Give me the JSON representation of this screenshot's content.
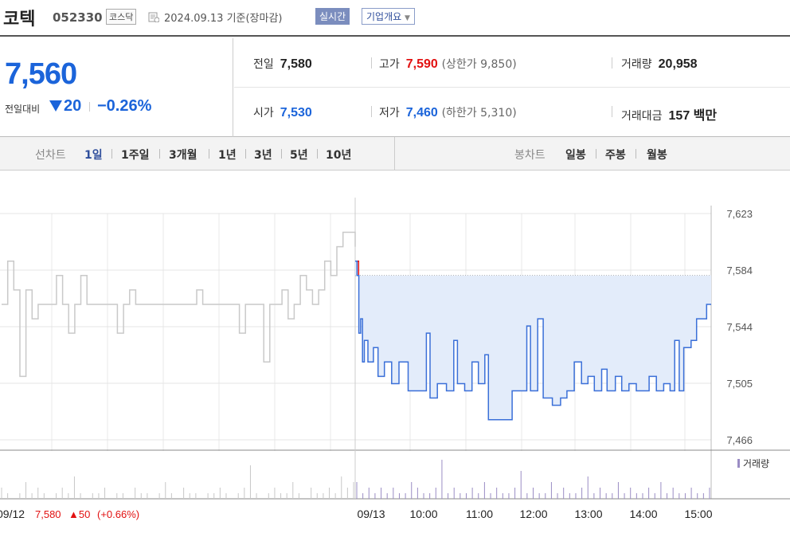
{
  "header": {
    "name": "코텍",
    "code": "052330",
    "market": "코스닥",
    "date": "2024.09.13  기준(장마감)",
    "realtime_label": "실시간",
    "corp_label": "기업개요"
  },
  "quote": {
    "price": "7,560",
    "change_label": "전일대비",
    "change_value": "20",
    "change_pct": "−0.26%",
    "prev_label": "전일",
    "prev": "7,580",
    "high_label": "고가",
    "high": "7,590",
    "upper_limit": "(상한가 9,850)",
    "volume_label": "거래량",
    "volume": "20,958",
    "open_label": "시가",
    "open": "7,530",
    "low_label": "저가",
    "low": "7,460",
    "lower_limit": "(하한가 5,310)",
    "amount_label": "거래대금",
    "amount": "157 백만"
  },
  "tabs": {
    "line_label": "선차트",
    "line": [
      "1일",
      "1주일",
      "3개월",
      "1년",
      "3년",
      "5년",
      "10년"
    ],
    "candle_label": "봉차트",
    "candle": [
      "일봉",
      "주봉",
      "월봉"
    ]
  },
  "colors": {
    "up": "#e21111",
    "down": "#1b64da",
    "line": "#3a6fd8",
    "fill": "#e3ecfa",
    "prev_line": "#c9c9c9"
  },
  "chart_data": {
    "type": "line",
    "y_ticks": [
      "7,623",
      "7,584",
      "7,544",
      "7,505",
      "7,466"
    ],
    "ylim": [
      7466,
      7623
    ],
    "x_ticks": [
      "09/13",
      "10:00",
      "11:00",
      "12:00",
      "13:00",
      "14:00",
      "15:00"
    ],
    "reference_price": 7580,
    "prev_day": {
      "label": "09/12",
      "close": "7,580",
      "change": "▲50",
      "pct": "(+0.66%)"
    },
    "prev_series": [
      7560,
      7590,
      7570,
      7510,
      7570,
      7550,
      7560,
      7560,
      7560,
      7580,
      7560,
      7540,
      7560,
      7580,
      7560,
      7560,
      7560,
      7560,
      7560,
      7540,
      7560,
      7570,
      7560,
      7560,
      7560,
      7560,
      7560,
      7560,
      7560,
      7560,
      7560,
      7560,
      7570,
      7560,
      7560,
      7560,
      7560,
      7560,
      7560,
      7540,
      7560,
      7560,
      7560,
      7520,
      7560,
      7560,
      7570,
      7550,
      7560,
      7580,
      7570,
      7560,
      7570,
      7590,
      7580,
      7600,
      7610,
      7610,
      7600
    ],
    "series": [
      {
        "t": "09:00",
        "v": 7590
      },
      {
        "t": "09:02",
        "v": 7580
      },
      {
        "t": "09:04",
        "v": 7540
      },
      {
        "t": "09:06",
        "v": 7550
      },
      {
        "t": "09:08",
        "v": 7520
      },
      {
        "t": "09:10",
        "v": 7535
      },
      {
        "t": "09:14",
        "v": 7520
      },
      {
        "t": "09:20",
        "v": 7530
      },
      {
        "t": "09:25",
        "v": 7510
      },
      {
        "t": "09:32",
        "v": 7520
      },
      {
        "t": "09:40",
        "v": 7505
      },
      {
        "t": "09:48",
        "v": 7520
      },
      {
        "t": "09:58",
        "v": 7500
      },
      {
        "t": "10:10",
        "v": 7500
      },
      {
        "t": "10:18",
        "v": 7540
      },
      {
        "t": "10:22",
        "v": 7495
      },
      {
        "t": "10:30",
        "v": 7505
      },
      {
        "t": "10:40",
        "v": 7500
      },
      {
        "t": "10:48",
        "v": 7535
      },
      {
        "t": "10:52",
        "v": 7505
      },
      {
        "t": "11:00",
        "v": 7500
      },
      {
        "t": "11:08",
        "v": 7520
      },
      {
        "t": "11:15",
        "v": 7505
      },
      {
        "t": "11:22",
        "v": 7525
      },
      {
        "t": "11:26",
        "v": 7480
      },
      {
        "t": "11:35",
        "v": 7480
      },
      {
        "t": "11:48",
        "v": 7480
      },
      {
        "t": "11:52",
        "v": 7500
      },
      {
        "t": "12:00",
        "v": 7500
      },
      {
        "t": "12:08",
        "v": 7545
      },
      {
        "t": "12:12",
        "v": 7500
      },
      {
        "t": "12:20",
        "v": 7550
      },
      {
        "t": "12:26",
        "v": 7495
      },
      {
        "t": "12:36",
        "v": 7490
      },
      {
        "t": "12:45",
        "v": 7495
      },
      {
        "t": "12:52",
        "v": 7500
      },
      {
        "t": "13:00",
        "v": 7520
      },
      {
        "t": "13:08",
        "v": 7505
      },
      {
        "t": "13:15",
        "v": 7510
      },
      {
        "t": "13:22",
        "v": 7500
      },
      {
        "t": "13:30",
        "v": 7515
      },
      {
        "t": "13:36",
        "v": 7500
      },
      {
        "t": "13:45",
        "v": 7510
      },
      {
        "t": "13:52",
        "v": 7500
      },
      {
        "t": "14:00",
        "v": 7505
      },
      {
        "t": "14:08",
        "v": 7500
      },
      {
        "t": "14:15",
        "v": 7500
      },
      {
        "t": "14:22",
        "v": 7510
      },
      {
        "t": "14:30",
        "v": 7500
      },
      {
        "t": "14:38",
        "v": 7505
      },
      {
        "t": "14:45",
        "v": 7500
      },
      {
        "t": "14:50",
        "v": 7535
      },
      {
        "t": "14:55",
        "v": 7500
      },
      {
        "t": "15:00",
        "v": 7530
      },
      {
        "t": "15:08",
        "v": 7535
      },
      {
        "t": "15:14",
        "v": 7550
      },
      {
        "t": "15:20",
        "v": 7550
      },
      {
        "t": "15:25",
        "v": 7560
      },
      {
        "t": "15:30",
        "v": 7560
      }
    ],
    "volume_legend": "거래량",
    "prev_volume": [
      2,
      1,
      0,
      1,
      3,
      1,
      2,
      1,
      0,
      1,
      2,
      1,
      4,
      1,
      0,
      1,
      1,
      2,
      0,
      1,
      1,
      0,
      2,
      1,
      1,
      0,
      1,
      3,
      1,
      0,
      2,
      1,
      1,
      0,
      1,
      1,
      2,
      1,
      0,
      1,
      2,
      6,
      1,
      0,
      1,
      2,
      1,
      1,
      3,
      1,
      0,
      2,
      1,
      1,
      2,
      1,
      4,
      2,
      3
    ],
    "volume": [
      3,
      1,
      2,
      1,
      2,
      1,
      2,
      1,
      1,
      3,
      2,
      1,
      1,
      2,
      7,
      1,
      2,
      1,
      1,
      2,
      1,
      3,
      1,
      2,
      1,
      1,
      2,
      5,
      1,
      2,
      1,
      1,
      3,
      1,
      2,
      1,
      1,
      2,
      4,
      1,
      2,
      1,
      1,
      3,
      1,
      2,
      1,
      1,
      2,
      1,
      3,
      1,
      2,
      1,
      1,
      2,
      1,
      1,
      2
    ]
  }
}
